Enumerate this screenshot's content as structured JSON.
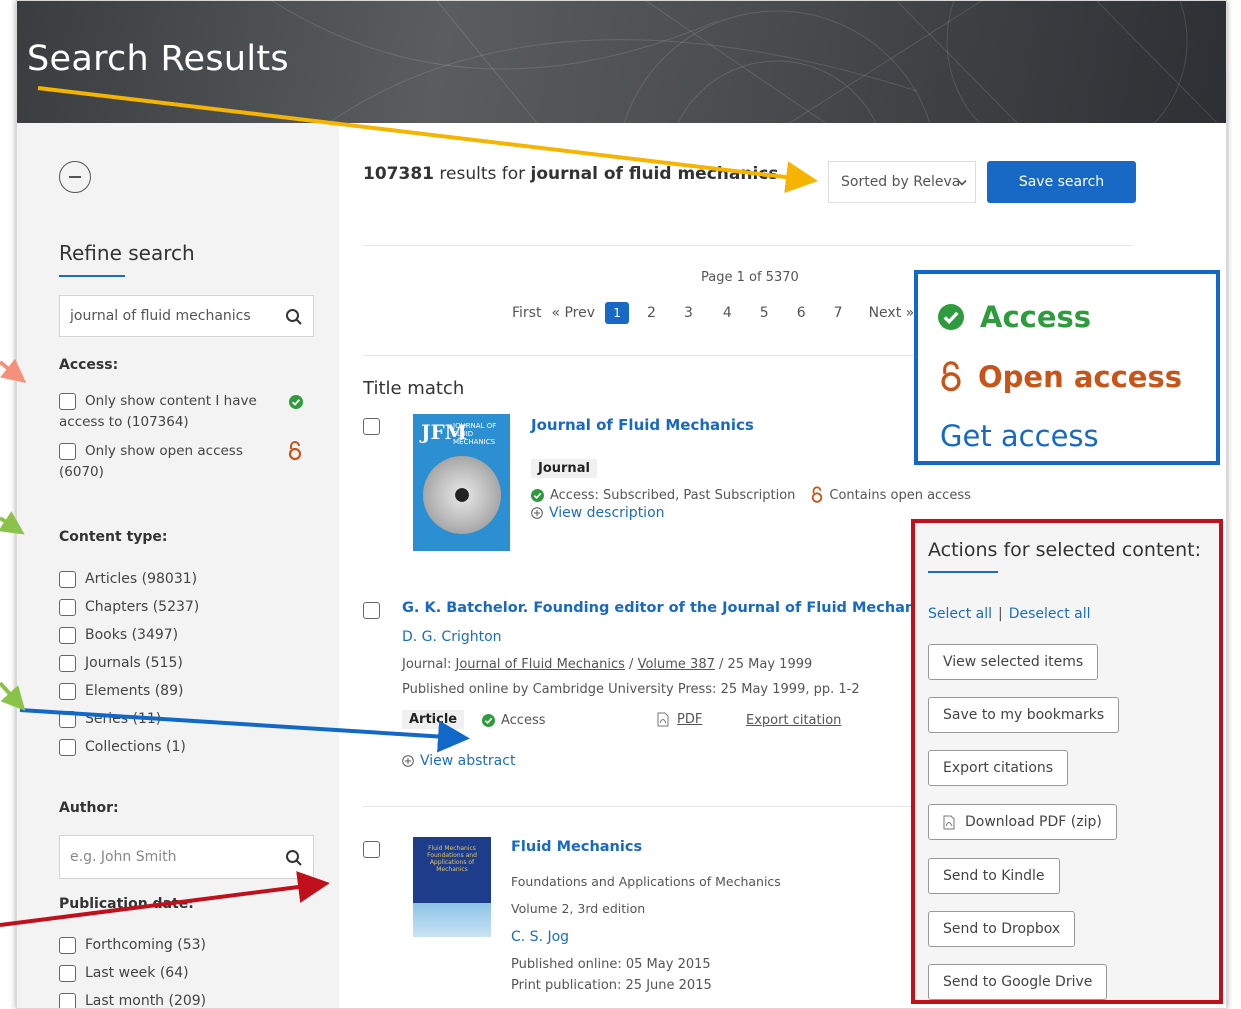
{
  "page": {
    "title": "Search Results"
  },
  "sidebar": {
    "refine_title": "Refine search",
    "search_value": "journal of fluid mechanics",
    "access": {
      "heading": "Access:",
      "items": [
        {
          "label": "Only show content I have",
          "label2": "access to (107364)"
        },
        {
          "label": "Only show open access",
          "label2": "(6070)"
        }
      ]
    },
    "content_type": {
      "heading": "Content type:",
      "items": [
        "Articles (98031)",
        "Chapters (5237)",
        "Books (3497)",
        "Journals (515)",
        "Elements (89)",
        "Series (11)",
        "Collections (1)"
      ]
    },
    "author": {
      "heading": "Author:",
      "placeholder": "e.g. John Smith"
    },
    "publication_date": {
      "heading": "Publication date:",
      "items": [
        "Forthcoming (53)",
        "Last week (64)",
        "Last month (209)"
      ]
    }
  },
  "results": {
    "count": "107381",
    "mid": " results for ",
    "query": "journal of fluid mechanics",
    "sort_label": "Sorted by Releva",
    "save_label": "Save search",
    "page_info": "Page 1 of 5370",
    "pagination": {
      "first": "First",
      "prev": "« Prev",
      "current": "1",
      "pages": [
        "2",
        "3",
        "4",
        "5",
        "6",
        "7"
      ],
      "next": "Next »"
    },
    "title_match_heading": "Title match",
    "items": [
      {
        "title": "Journal of Fluid Mechanics",
        "cover_text": "JOURNAL OF FLUID MECHANICS",
        "cover_logo": "JFM",
        "type": "Journal",
        "access": "Access: Subscribed, Past Subscription",
        "open_access": "Contains open access",
        "expand": "View description"
      },
      {
        "title": "G. K. Batchelor. Founding editor of the Journal of Fluid Mechanics",
        "author": "D. G. Crighton",
        "journal_prefix": "Journal: ",
        "journal": "Journal of Fluid Mechanics",
        "sep": " / ",
        "volume": "Volume 387",
        "date": " / 25 May 1999",
        "published": "Published online by Cambridge University Press: 25 May 1999, pp. 1-2",
        "type": "Article",
        "access": "Access",
        "pdf": "PDF",
        "export": "Export citation",
        "expand": "View abstract"
      },
      {
        "title": "Fluid Mechanics",
        "cover_text": "Fluid Mechanics Foundations and Applications of Mechanics",
        "subtitle": "Foundations and Applications of Mechanics",
        "edition": "Volume 2, 3rd edition",
        "author": "C. S. Jog",
        "published_online": "Published online: 05 May 2015",
        "print_publication": "Print publication: 25 June 2015"
      }
    ]
  },
  "legend": {
    "access": "Access",
    "open_access": "Open access",
    "get_access": "Get access"
  },
  "actions": {
    "title": "Actions for selected content:",
    "select_all": "Select all",
    "divider": "|",
    "deselect_all": "Deselect all",
    "buttons": [
      "View selected items",
      "Save to my bookmarks",
      "Export citations",
      "Download PDF (zip)",
      "Send to Kindle",
      "Send to Dropbox",
      "Send to Google Drive"
    ]
  },
  "colors": {
    "accent": "#1769c5",
    "access_green": "#2e9b3c",
    "open_access_orange": "#c7551a",
    "annotation_yellow": "#f5b400",
    "annotation_blue": "#1268c6",
    "annotation_red": "#c1101b",
    "annotation_green": "#8bc34a",
    "annotation_salmon": "#f4917a"
  },
  "icons": [
    "search-icon",
    "check-circle-icon",
    "open-lock-icon",
    "plus-circle-icon",
    "pdf-icon",
    "collapse-icon"
  ]
}
